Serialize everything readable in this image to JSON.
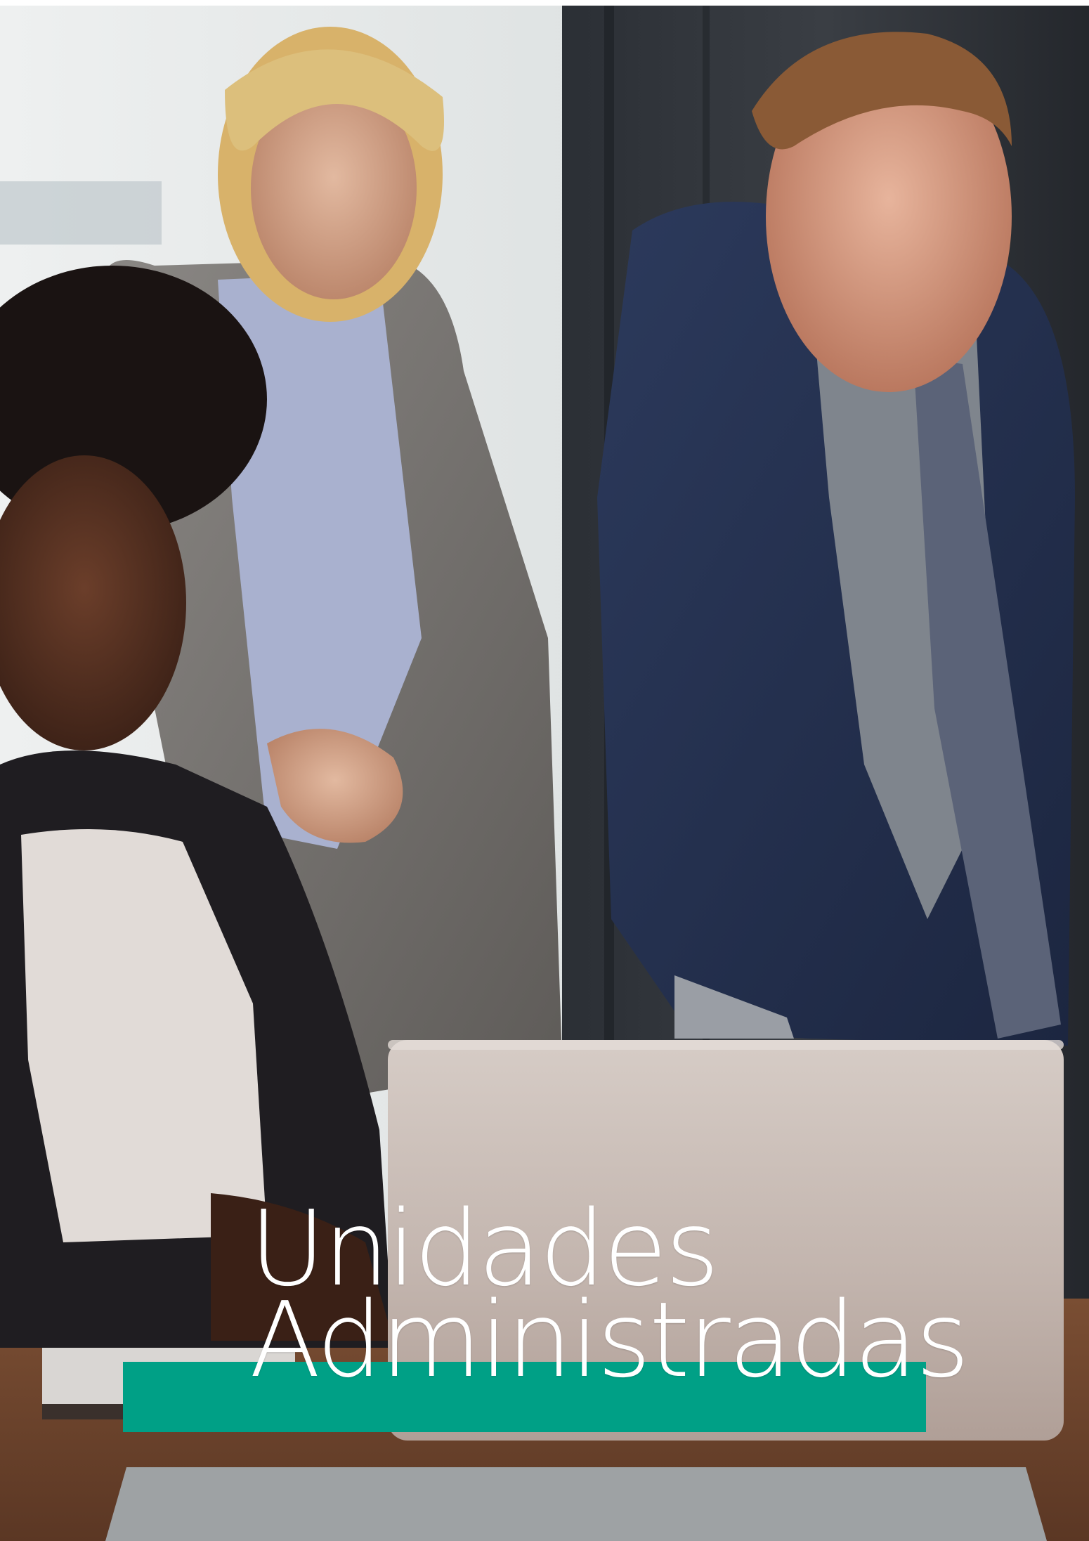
{
  "cover": {
    "title_line_1": "Unidades",
    "title_line_2": "Administradas",
    "accent_color": "#00a086",
    "photo_subject": "three-colleagues-at-laptop"
  }
}
